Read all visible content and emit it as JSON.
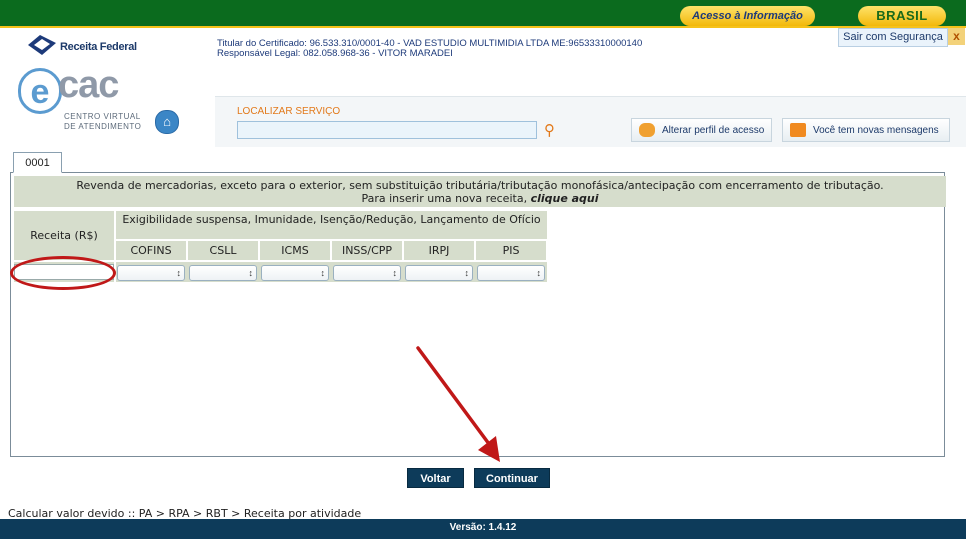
{
  "topbar": {
    "acesso_label": "Acesso à Informação",
    "brasil_label": "BRASIL",
    "sair_label": "Sair com Segurança",
    "sair_close": "x"
  },
  "header": {
    "brand": "Receita Federal",
    "cert_titular": "Titular do Certificado: 96.533.310/0001-40 - VAD ESTUDIO MULTIMIDIA LTDA ME:96533310000140",
    "cert_responsavel": "Responsável Legal: 082.058.968-36 - VITOR MARADEI",
    "ecac_e": "e",
    "ecac_cac": "cac",
    "ecac_sub1": "CENTRO VIRTUAL",
    "ecac_sub2": "DE ATENDIMENTO",
    "home_icon": "home-icon",
    "localizar_label": "LOCALIZAR SERVIÇO",
    "localizar_value": "",
    "btn_perfil": "Alterar perfil de acesso",
    "btn_msgs": "Você tem novas mensagens"
  },
  "tab": {
    "label": "0001"
  },
  "info": {
    "line1": "Revenda de mercadorias, exceto para o exterior, sem substituição tributária/tributação monofásica/antecipação com encerramento de tributação.",
    "line2_prefix": "Para inserir uma nova receita,",
    "line2_link": "clique aqui"
  },
  "table": {
    "col_receita": "Receita (R$)",
    "exig_header": "Exigibilidade suspensa, Imunidade, Isenção/Redução, Lançamento de Ofício",
    "subcols": [
      "COFINS",
      "CSLL",
      "ICMS",
      "INSS/CPP",
      "IRPJ",
      "PIS"
    ],
    "receita_value": "",
    "select_values": [
      "",
      "",
      "",
      "",
      "",
      ""
    ]
  },
  "actions": {
    "voltar": "Voltar",
    "continuar": "Continuar"
  },
  "breadcrumb": "Calcular valor devido :: PA > RPA > RBT > Receita por atividade",
  "footer": "Versão: 1.4.12",
  "colors": {
    "dark_blue": "#0d3b5a",
    "green": "#0b6b1e",
    "table_bg": "#d6ddcc",
    "annotation_red": "#c01818",
    "orange": "#e2791a"
  }
}
